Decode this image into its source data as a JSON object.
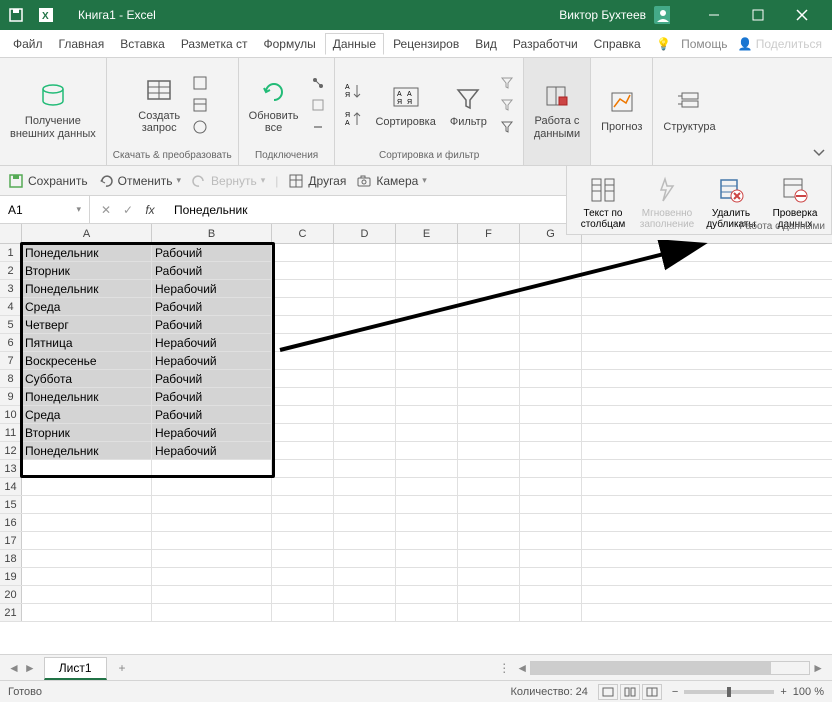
{
  "titlebar": {
    "title": "Книга1 - Excel",
    "user": "Виктор Бухтеев"
  },
  "menu": {
    "items": [
      "Файл",
      "Главная",
      "Вставка",
      "Разметка ст",
      "Формулы",
      "Данные",
      "Рецензиров",
      "Вид",
      "Разработчи",
      "Справка"
    ],
    "active": 5,
    "help": "Помощь",
    "share": "Поделиться"
  },
  "ribbon": {
    "g1": {
      "btn": "Получение\nвнешних данных"
    },
    "g2": {
      "btn": "Создать\nзапрос",
      "label": "Скачать & преобразовать"
    },
    "g3": {
      "btn": "Обновить\nвсе",
      "label": "Подключения"
    },
    "g4": {
      "sort": "Сортировка",
      "label": "Сортировка и фильтр",
      "filter": "Фильтр"
    },
    "g5": {
      "btn": "Работа с\nданными"
    },
    "g6": {
      "btn": "Прогноз"
    },
    "g7": {
      "btn": "Структура"
    }
  },
  "qat": {
    "save": "Сохранить",
    "undo": "Отменить",
    "redo": "Вернуть",
    "other": "Другая",
    "camera": "Камера"
  },
  "datatools": {
    "b1": "Текст по\nстолбцам",
    "b2": "Мгновенно\nзаполнение",
    "b3": "Удалить\nдубликаты",
    "b4": "Проверка\nданных",
    "label": "Работа с данными"
  },
  "formula": {
    "name": "A1",
    "value": "Понедельник"
  },
  "cols": [
    "A",
    "B",
    "C",
    "D",
    "E",
    "F",
    "G"
  ],
  "data": [
    [
      "Понедельник",
      "Рабочий"
    ],
    [
      "Вторник",
      "Рабочий"
    ],
    [
      "Понедельник",
      "Нерабочий"
    ],
    [
      "Среда",
      "Рабочий"
    ],
    [
      "Четверг",
      "Рабочий"
    ],
    [
      "Пятница",
      "Нерабочий"
    ],
    [
      "Воскресенье",
      "Нерабочий"
    ],
    [
      "Суббота",
      "Рабочий"
    ],
    [
      "Понедельник",
      "Рабочий"
    ],
    [
      "Среда",
      "Рабочий"
    ],
    [
      "Вторник",
      "Нерабочий"
    ],
    [
      "Понедельник",
      "Нерабочий"
    ]
  ],
  "emptyrows": 9,
  "sheet": "Лист1",
  "status": {
    "ready": "Готово",
    "count": "Количество: 24",
    "zoom": "100 %"
  }
}
